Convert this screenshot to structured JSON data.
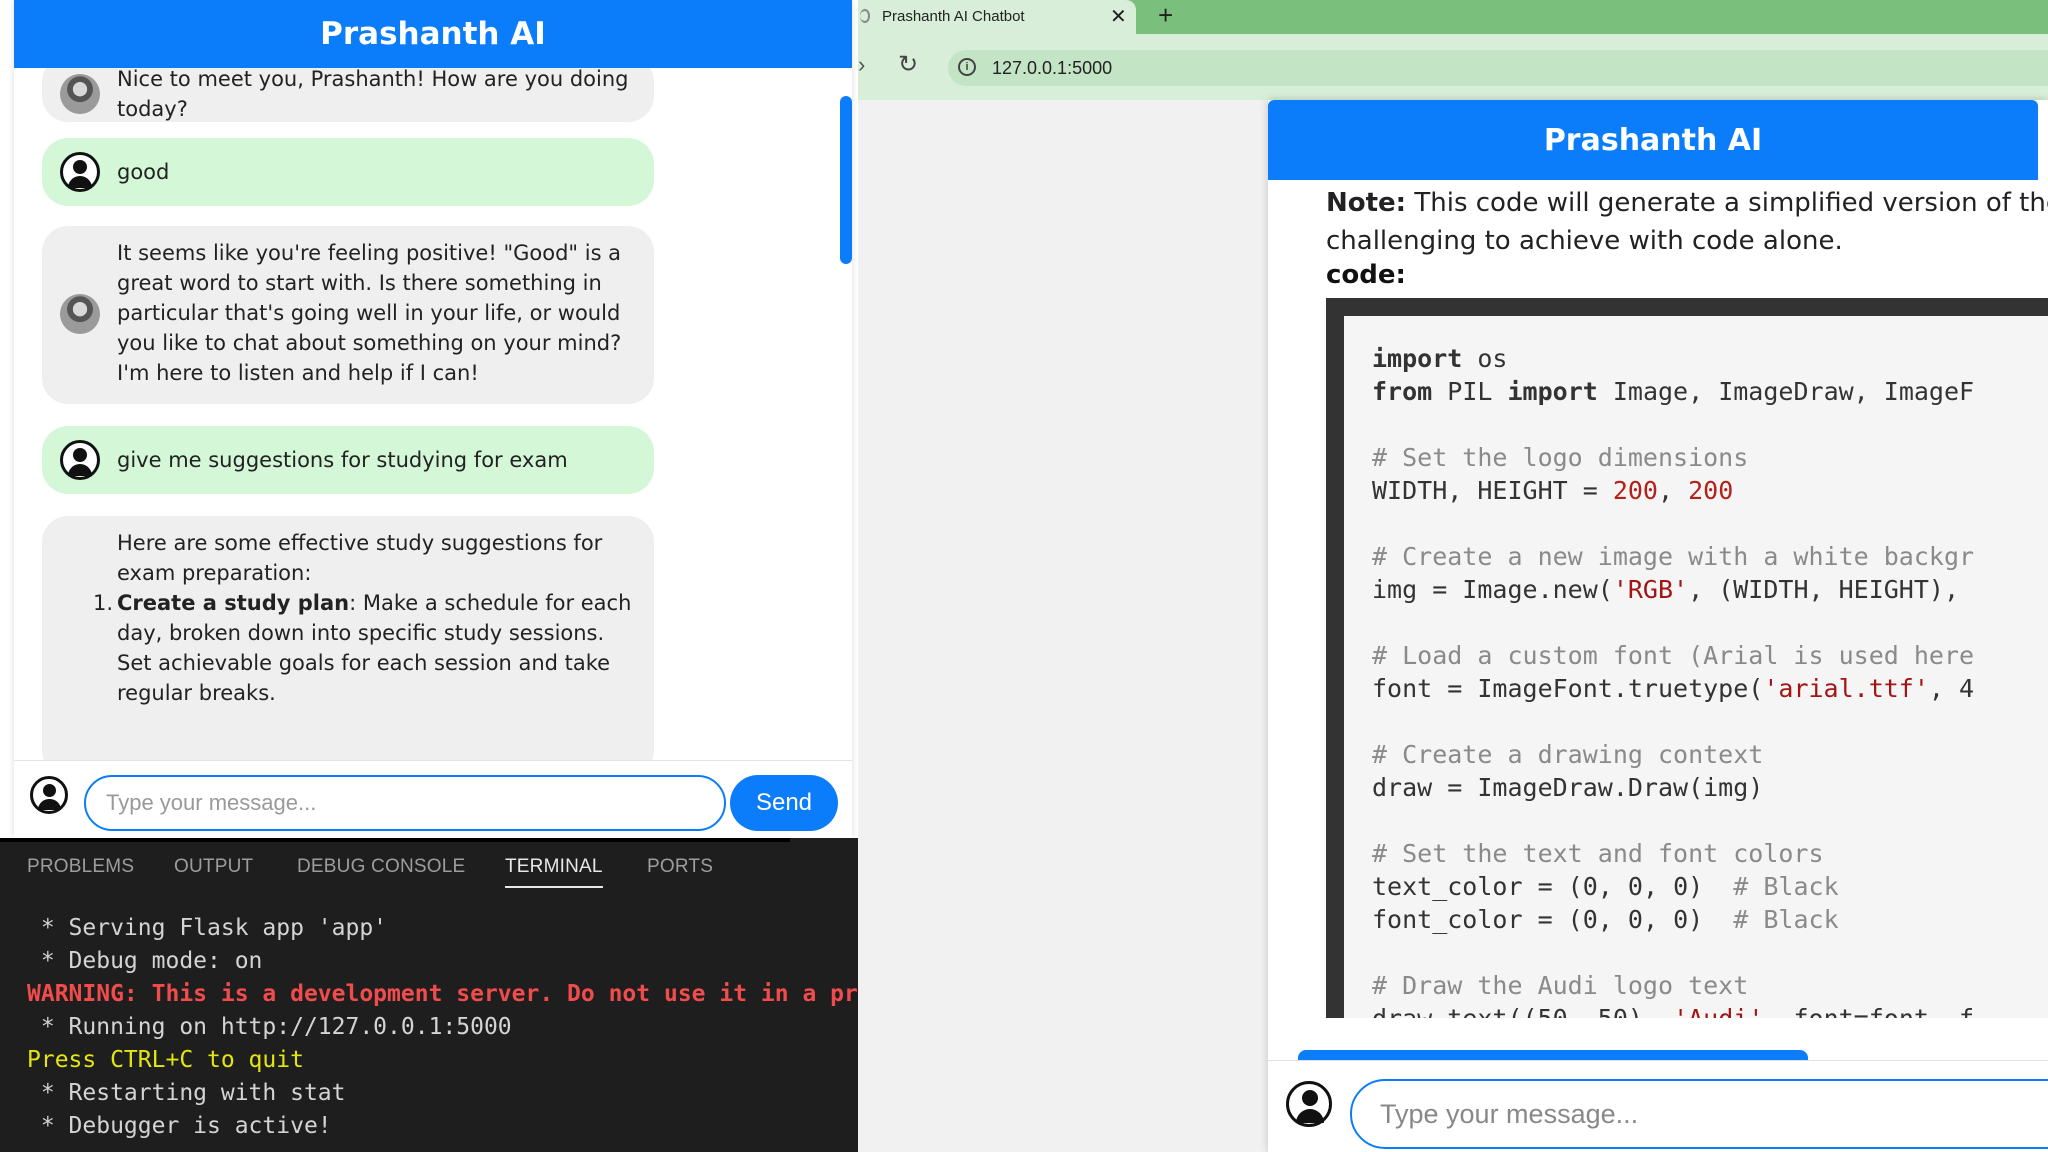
{
  "left_chat": {
    "title": "Prashanth AI",
    "messages": [
      {
        "role": "bot",
        "text": "Nice to meet you, Prashanth! How are you doing today?"
      },
      {
        "role": "user",
        "text": "good"
      },
      {
        "role": "bot",
        "text": "It seems like you're feeling positive! \"Good\" is a great word to start with. Is there something in particular that's going well in your life, or would you like to chat about something on your mind? I'm here to listen and help if I can!"
      },
      {
        "role": "user",
        "text": "give me suggestions for studying for exam"
      },
      {
        "role": "bot",
        "intro": "Here are some effective study suggestions for exam preparation:",
        "item_number": "1.",
        "item_title": "Create a study plan",
        "item_text": ": Make a schedule for each day, broken down into specific study sessions. Set achievable goals for each session and take regular breaks."
      }
    ],
    "input_placeholder": "Type your message...",
    "send_label": "Send"
  },
  "terminal": {
    "tabs": [
      "PROBLEMS",
      "OUTPUT",
      "DEBUG CONSOLE",
      "TERMINAL",
      "PORTS"
    ],
    "active_tab": "TERMINAL",
    "lines": [
      {
        "type": "normal",
        "text": " * Serving Flask app 'app'"
      },
      {
        "type": "normal",
        "text": " * Debug mode: on"
      },
      {
        "type": "warn",
        "text": "WARNING: This is a development server. Do not use it in a production deployment. Use a productio"
      },
      {
        "type": "normal",
        "text": " * Running on http://127.0.0.1:5000"
      },
      {
        "type": "yellow",
        "text": "Press CTRL+C to quit"
      },
      {
        "type": "normal",
        "text": " * Restarting with stat"
      },
      {
        "type": "normal",
        "text": " * Debugger is active!"
      }
    ]
  },
  "browser": {
    "tab_title": "Prashanth AI Chatbot",
    "url": "127.0.0.1:5000",
    "panel": {
      "title": "Prashanth AI",
      "note_label": "Note:",
      "note_text": " This code will generate a simplified version of the A",
      "note_text_line2": "challenging to achieve with code alone.",
      "code_label": "code:",
      "input_placeholder": "Type your message..."
    },
    "code_lines": [
      [
        {
          "t": "kw",
          "v": "import"
        },
        {
          "t": "p",
          "v": " os"
        }
      ],
      [
        {
          "t": "kw",
          "v": "from"
        },
        {
          "t": "p",
          "v": " PIL "
        },
        {
          "t": "kw",
          "v": "import"
        },
        {
          "t": "p",
          "v": " Image, ImageDraw, ImageF"
        }
      ],
      [],
      [
        {
          "t": "cm",
          "v": "# Set the logo dimensions"
        }
      ],
      [
        {
          "t": "p",
          "v": "WIDTH, HEIGHT = "
        },
        {
          "t": "num",
          "v": "200"
        },
        {
          "t": "p",
          "v": ", "
        },
        {
          "t": "num",
          "v": "200"
        }
      ],
      [],
      [
        {
          "t": "cm",
          "v": "# Create a new image with a white backgr"
        }
      ],
      [
        {
          "t": "p",
          "v": "img = Image.new("
        },
        {
          "t": "str",
          "v": "'RGB'"
        },
        {
          "t": "p",
          "v": ", (WIDTH, HEIGHT), "
        }
      ],
      [],
      [
        {
          "t": "cm",
          "v": "# Load a custom font (Arial is used here"
        }
      ],
      [
        {
          "t": "p",
          "v": "font = ImageFont.truetype("
        },
        {
          "t": "str",
          "v": "'arial.ttf'"
        },
        {
          "t": "p",
          "v": ", 4"
        }
      ],
      [],
      [
        {
          "t": "cm",
          "v": "# Create a drawing context"
        }
      ],
      [
        {
          "t": "p",
          "v": "draw = ImageDraw.Draw(img)"
        }
      ],
      [],
      [
        {
          "t": "cm",
          "v": "# Set the text and font colors"
        }
      ],
      [
        {
          "t": "p",
          "v": "text_color = ("
        },
        {
          "t": "p",
          "v": "0"
        },
        {
          "t": "p",
          "v": ", "
        },
        {
          "t": "p",
          "v": "0"
        },
        {
          "t": "p",
          "v": ", "
        },
        {
          "t": "p",
          "v": "0"
        },
        {
          "t": "p",
          "v": ")  "
        },
        {
          "t": "cm",
          "v": "# Black"
        }
      ],
      [
        {
          "t": "p",
          "v": "font_color = ("
        },
        {
          "t": "p",
          "v": "0"
        },
        {
          "t": "p",
          "v": ", "
        },
        {
          "t": "p",
          "v": "0"
        },
        {
          "t": "p",
          "v": ", "
        },
        {
          "t": "p",
          "v": "0"
        },
        {
          "t": "p",
          "v": ")  "
        },
        {
          "t": "cm",
          "v": "# Black"
        }
      ],
      [],
      [
        {
          "t": "cm",
          "v": "# Draw the Audi logo text"
        }
      ],
      [
        {
          "t": "p",
          "v": "draw.text(("
        },
        {
          "t": "p",
          "v": "50"
        },
        {
          "t": "p",
          "v": ", "
        },
        {
          "t": "p",
          "v": "50"
        },
        {
          "t": "p",
          "v": "), "
        },
        {
          "t": "str",
          "v": "'Audi'"
        },
        {
          "t": "p",
          "v": ", font=font, f"
        }
      ]
    ]
  },
  "colors": {
    "accent": "#0b7dfa",
    "user_bubble": "#d4f7d8",
    "bot_bubble": "#efefef",
    "terminal_bg": "#1e1e1e",
    "terminal_warning": "#f14c4c",
    "terminal_yellow": "#e5e510",
    "browser_chrome": "#7bbf7d"
  },
  "icons": {
    "bot_avatar": "bot-avatar-icon",
    "user_avatar": "user-avatar-icon",
    "reload": "reload-icon",
    "info": "info-icon",
    "close": "close-icon",
    "new_tab": "plus-icon"
  }
}
